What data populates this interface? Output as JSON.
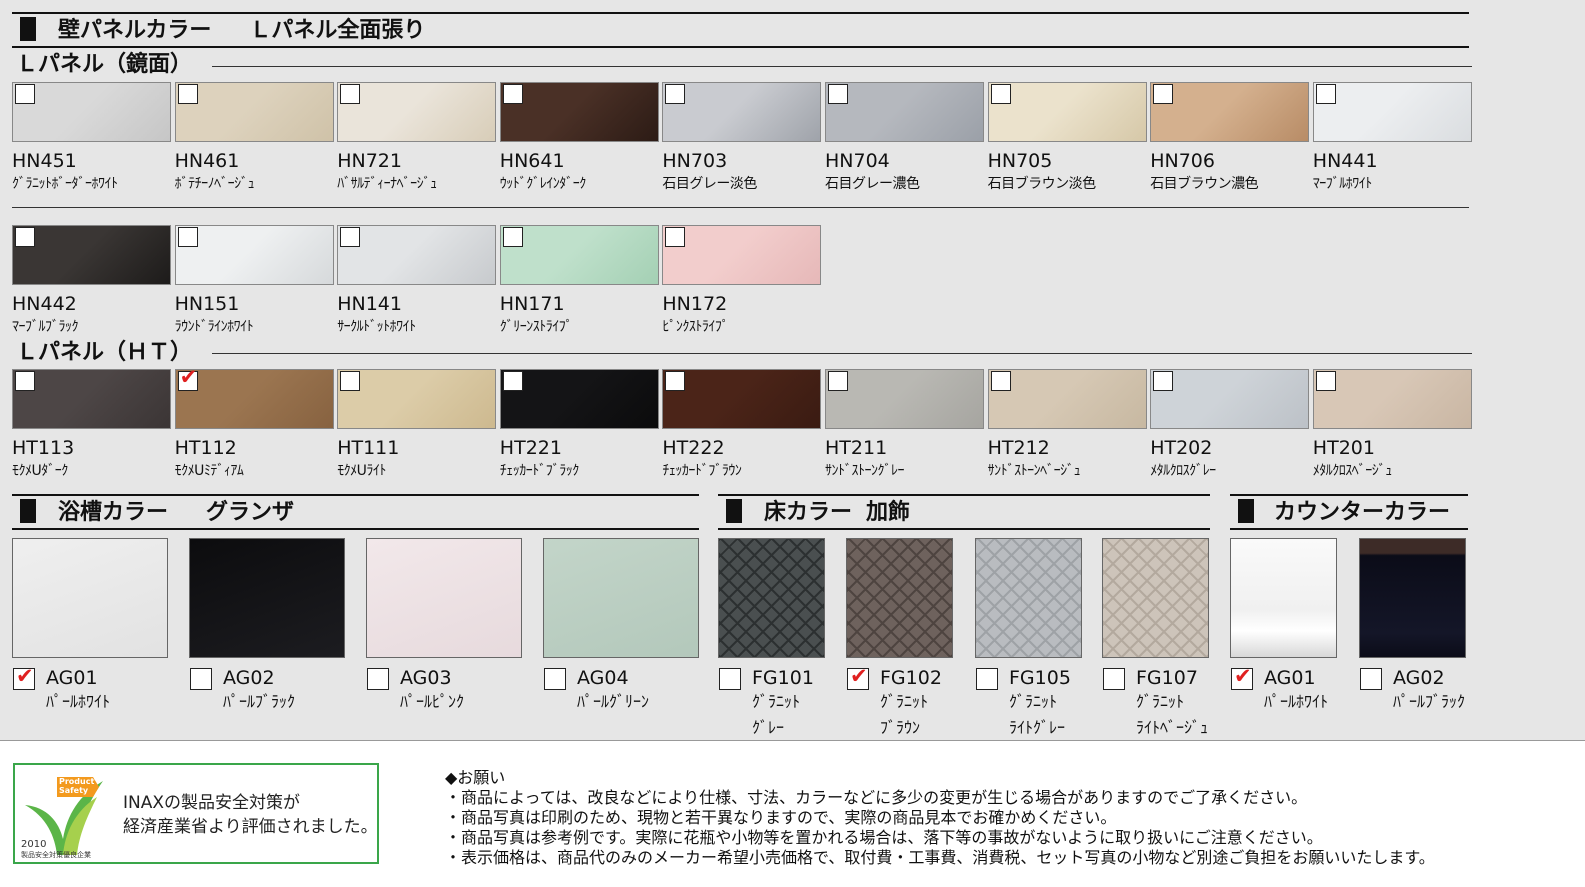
{
  "wall": {
    "header_label": "壁パネルカラー",
    "header_sub": "Ｌパネル全面張り",
    "mirror_title": "Ｌパネル（鏡面）",
    "mirror_row1": [
      {
        "code": "HN451",
        "name": "ｸﾞﾗﾆｯﾄﾎﾞｰﾀﾞｰﾎﾜｲﾄ",
        "checked": false,
        "color": "#d9d9d9",
        "color2": "#c6c6c6"
      },
      {
        "code": "HN461",
        "name": "ﾎﾞﾃﾁｰﾉﾍﾞｰｼﾞｭ",
        "checked": false,
        "color": "#ddd2bd",
        "color2": "#cfc2a8"
      },
      {
        "code": "HN721",
        "name": "ﾊﾞｻﾙﾃﾞｨｰﾅﾍﾞｰｼﾞｭ",
        "checked": false,
        "color": "#eae4da",
        "color2": "#d8cdb8"
      },
      {
        "code": "HN641",
        "name": "ｳｯﾄﾞｸﾞﾚｲﾝﾀﾞｰｸ",
        "checked": false,
        "color": "#4a3026",
        "color2": "#2c1b15"
      },
      {
        "code": "HN703",
        "name": "石目グレー淡色",
        "checked": false,
        "color": "#c9cbd0",
        "color2": "#9fa3aa"
      },
      {
        "code": "HN704",
        "name": "石目グレー濃色",
        "checked": false,
        "color": "#b5b8be",
        "color2": "#9ba0a8"
      },
      {
        "code": "HN705",
        "name": "石目ブラウン淡色",
        "checked": false,
        "color": "#ebe2cc",
        "color2": "#d6c8a8"
      },
      {
        "code": "HN706",
        "name": "石目ブラウン濃色",
        "checked": false,
        "color": "#d4b08e",
        "color2": "#b88c66"
      },
      {
        "code": "HN441",
        "name": "ﾏｰﾌﾞﾙﾎﾜｲﾄ",
        "checked": false,
        "color": "#eceef0",
        "color2": "#dadde0"
      }
    ],
    "mirror_row2": [
      {
        "code": "HN442",
        "name": "ﾏｰﾌﾞﾙﾌﾞﾗｯｸ",
        "checked": false,
        "color": "#3a3634",
        "color2": "#1d1b1a"
      },
      {
        "code": "HN151",
        "name": "ﾗｳﾝﾄﾞﾗｲﾝﾎﾜｲﾄ",
        "checked": false,
        "color": "#eef0f1",
        "color2": "#d6d9db"
      },
      {
        "code": "HN141",
        "name": "ｻｰｸﾙﾄﾞｯﾄﾎﾜｲﾄ",
        "checked": false,
        "color": "#e2e4e6",
        "color2": "#c7cacd"
      },
      {
        "code": "HN171",
        "name": "ｸﾞﾘｰﾝｽﾄﾗｲﾌﾟ",
        "checked": false,
        "color": "#bfe0cb",
        "color2": "#a4d0b4"
      },
      {
        "code": "HN172",
        "name": "ﾋﾟﾝｸｽﾄﾗｲﾌﾟ",
        "checked": false,
        "color": "#f2cdcc",
        "color2": "#e6b8b8"
      }
    ],
    "ht_title": "Ｌパネル（ＨＴ）",
    "ht_row": [
      {
        "code": "HT113",
        "name": "ﾓｸﾒUﾀﾞｰｸ",
        "checked": false,
        "color": "#4d4646",
        "color2": "#3b3535"
      },
      {
        "code": "HT112",
        "name": "ﾓｸﾒUﾐﾃﾞｨｱﾑ",
        "checked": true,
        "color": "#9b7550",
        "color2": "#876240"
      },
      {
        "code": "HT111",
        "name": "ﾓｸﾒUﾗｲﾄ",
        "checked": false,
        "color": "#dccca8",
        "color2": "#cdb98f"
      },
      {
        "code": "HT221",
        "name": "ﾁｪｯｶｰﾄﾞﾌﾞﾗｯｸ",
        "checked": false,
        "color": "#141416",
        "color2": "#0b0b0c"
      },
      {
        "code": "HT222",
        "name": "ﾁｪｯｶｰﾄﾞﾌﾞﾗｳﾝ",
        "checked": false,
        "color": "#4b2418",
        "color2": "#3a1b12"
      },
      {
        "code": "HT211",
        "name": "ｻﾝﾄﾞｽﾄｰﾝｸﾞﾚｰ",
        "checked": false,
        "color": "#b9b8b3",
        "color2": "#a6a5a0"
      },
      {
        "code": "HT212",
        "name": "ｻﾝﾄﾞｽﾄｰﾝﾍﾞｰｼﾞｭ",
        "checked": false,
        "color": "#d6c8b4",
        "color2": "#c7b8a1"
      },
      {
        "code": "HT202",
        "name": "ﾒﾀﾙｸﾛｽｸﾞﾚｰ",
        "checked": false,
        "color": "#ced3d8",
        "color2": "#bcc1c7"
      },
      {
        "code": "HT201",
        "name": "ﾒﾀﾙｸﾛｽﾍﾞｰｼﾞｭ",
        "checked": false,
        "color": "#d8c7b6",
        "color2": "#c9b6a3"
      }
    ]
  },
  "bath": {
    "header_label": "浴槽カラー",
    "header_sub": "グランザ",
    "items": [
      {
        "code": "AG01",
        "name": "ﾊﾟｰﾙﾎﾜｲﾄ",
        "checked": true,
        "color": "#efefef",
        "color2": "#e2e2e2"
      },
      {
        "code": "AG02",
        "name": "ﾊﾟｰﾙﾌﾞﾗｯｸ",
        "checked": false,
        "color": "#0c0c0e",
        "color2": "#1c1c20"
      },
      {
        "code": "AG03",
        "name": "ﾊﾟｰﾙﾋﾟﾝｸ",
        "checked": false,
        "color": "#f2e8ea",
        "color2": "#e7dadd"
      },
      {
        "code": "AG04",
        "name": "ﾊﾟｰﾙｸﾞﾘｰﾝ",
        "checked": false,
        "color": "#c3d5c9",
        "color2": "#b3c8bb"
      }
    ]
  },
  "floor": {
    "header_label": "床カラー",
    "header_sub": "加飾",
    "items": [
      {
        "code": "FG101",
        "name_lines": [
          "ｸﾞﾗﾆｯﾄ",
          "ｸﾞﾚｰ"
        ],
        "checked": false,
        "color": "#4a4f50",
        "color2": "#2c3031"
      },
      {
        "code": "FG102",
        "name_lines": [
          "ｸﾞﾗﾆｯﾄ",
          "ﾌﾞﾗｳﾝ"
        ],
        "checked": true,
        "color": "#6e625d",
        "color2": "#4e4440"
      },
      {
        "code": "FG105",
        "name_lines": [
          "ｸﾞﾗﾆｯﾄ",
          "ﾗｲﾄｸﾞﾚｰ"
        ],
        "checked": false,
        "color": "#b9bcc0",
        "color2": "#9ea2a6"
      },
      {
        "code": "FG107",
        "name_lines": [
          "ｸﾞﾗﾆｯﾄ",
          "ﾗｲﾄﾍﾞｰｼﾞｭ"
        ],
        "checked": false,
        "color": "#cdc4ba",
        "color2": "#b3a99e"
      }
    ]
  },
  "counter": {
    "header_label": "カウンターカラー",
    "items": [
      {
        "code": "AG01",
        "name": "ﾊﾟｰﾙﾎﾜｲﾄ",
        "checked": true,
        "color": "#f4f4f4",
        "color2": "#dadada"
      },
      {
        "code": "AG02",
        "name": "ﾊﾟｰﾙﾌﾞﾗｯｸ",
        "checked": false,
        "color": "#0c0d1a",
        "color2": "#3a2a2a"
      }
    ]
  },
  "badge": {
    "line1": "INAXの製品安全対策が",
    "line2": "経済産業省より評価されました。",
    "logo_top": "Product",
    "logo_bottom": "Safety",
    "year": "2010",
    "award": "製品安全対策優良企業"
  },
  "notice": {
    "title": "◆お願い",
    "lines": [
      "・商品によっては、改良などにより仕様、寸法、カラーなどに多少の変更が生じる場合がありますのでご了承ください。",
      "・商品写真は印刷のため、現物と若干異なりますので、実際の商品見本でお確かめください。",
      "・商品写真は参考例です。実際に花瓶や小物等を置かれる場合は、落下等の事故がないように取り扱いにご注意ください。",
      "・表示価格は、商品代のみのメーカー希望小売価格で、取付費・工事費、消費税、セット写真の小物など別途ご負担をお願いいたします。"
    ]
  },
  "colors": {
    "accent_red": "#e02020",
    "badge_green": "#3aa64a"
  }
}
